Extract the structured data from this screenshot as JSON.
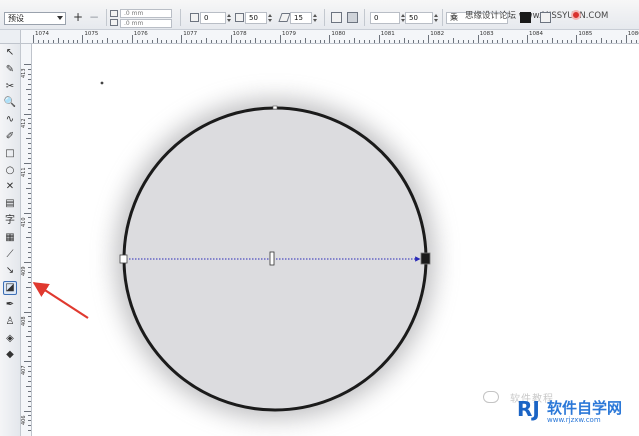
{
  "property_bar": {
    "preset": "预设",
    "add_preset_glyph": "+",
    "remove_preset_glyph": "−",
    "offset_x": ".0 mm",
    "offset_y": ".0 mm",
    "angle_a": "0",
    "angle_b": "50",
    "width_value": "15",
    "transparency_start": "0",
    "transparency_end": "50",
    "merge_mode_label": "乘",
    "colors": {
      "fill_swatch": "#1a1a1a",
      "accent": "#d9322e"
    }
  },
  "watermark": {
    "site_text": "思缘设计论坛 www.MISSYUAN.COM",
    "wechat_text": "软件教程",
    "brand_rj": "RJ",
    "brand_name": "软件自学网",
    "brand_url": "www.rjzxw.com"
  },
  "ruler": {
    "top_labels": [
      "1074",
      "1075",
      "1076",
      "1077",
      "1078",
      "1079",
      "1080",
      "1081",
      "1082",
      "1083",
      "1084",
      "1085",
      "1086"
    ],
    "left_labels": [
      "413",
      "412",
      "411",
      "410",
      "409",
      "408",
      "407",
      "406"
    ]
  },
  "toolbox": {
    "tools": [
      {
        "name": "pick-tool",
        "glyph": "↖"
      },
      {
        "name": "shape-tool",
        "glyph": "✎"
      },
      {
        "name": "crop-tool",
        "glyph": "✂"
      },
      {
        "name": "zoom-tool",
        "glyph": "🔍"
      },
      {
        "name": "freehand-tool",
        "glyph": "∿"
      },
      {
        "name": "smart-drawing-tool",
        "glyph": "✐"
      },
      {
        "name": "rectangle-tool",
        "glyph": "□"
      },
      {
        "name": "ellipse-tool",
        "glyph": "○"
      },
      {
        "name": "polygon-tool",
        "glyph": "✕"
      },
      {
        "name": "basic-shapes-tool",
        "glyph": "▤"
      },
      {
        "name": "text-tool",
        "glyph": "字"
      },
      {
        "name": "table-tool",
        "glyph": "▦"
      },
      {
        "name": "dimension-tool",
        "glyph": "⟋"
      },
      {
        "name": "connector-tool",
        "glyph": "↘"
      },
      {
        "name": "drop-shadow-tool",
        "glyph": "◪"
      },
      {
        "name": "eyedropper-tool",
        "glyph": "✒"
      },
      {
        "name": "outline-pen-tool",
        "glyph": "♙"
      },
      {
        "name": "fill-tool",
        "glyph": "◈"
      },
      {
        "name": "interactive-fill-tool",
        "glyph": "◆"
      }
    ]
  }
}
